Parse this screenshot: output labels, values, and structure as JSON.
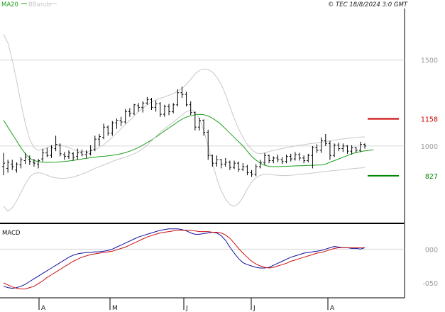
{
  "header": {
    "legend": [
      {
        "label": "MA20",
        "color": "#1aa01a"
      },
      {
        "label": "BBands",
        "color": "#c8c8c8"
      }
    ],
    "copyright": "© TEC 18/8/2024 3:0 GMT"
  },
  "chart_data": [
    {
      "type": "ohlc",
      "panel": "price",
      "title": "",
      "yticks": [
        "1500",
        "1000"
      ],
      "ylim": [
        550,
        1800
      ],
      "price_lines": [
        {
          "label": "1158",
          "value": 1158,
          "color": "#cc0000"
        },
        {
          "label": "827",
          "value": 827,
          "color": "#008800"
        }
      ],
      "series": [
        {
          "name": "MA20",
          "color": "#1aa01a",
          "values": [
            1150,
            1110,
            1070,
            1030,
            990,
            955,
            930,
            915,
            910,
            905,
            905,
            905,
            906,
            908,
            910,
            913,
            916,
            920,
            924,
            928,
            932,
            935,
            938,
            940,
            943,
            946,
            950,
            955,
            962,
            970,
            980,
            992,
            1005,
            1020,
            1035,
            1052,
            1070,
            1088,
            1105,
            1122,
            1140,
            1156,
            1168,
            1176,
            1182,
            1184,
            1182,
            1175,
            1162,
            1145,
            1125,
            1100,
            1075,
            1050,
            1025,
            1000,
            970,
            940,
            918,
            900,
            888,
            882,
            880,
            880,
            881,
            882,
            883,
            884,
            885,
            886,
            887,
            888,
            889,
            890,
            895,
            905,
            915,
            925,
            935,
            945,
            955,
            962,
            968,
            972,
            975,
            978
          ]
        },
        {
          "name": "BBands upper",
          "color": "#c8c8c8",
          "values": [
            1650,
            1600,
            1500,
            1380,
            1250,
            1130,
            1040,
            990,
            975,
            980,
            990,
            1000,
            1005,
            1005,
            1000,
            990,
            980,
            972,
            968,
            968,
            972,
            980,
            992,
            1008,
            1028,
            1050,
            1075,
            1100,
            1125,
            1150,
            1175,
            1200,
            1220,
            1240,
            1255,
            1268,
            1278,
            1286,
            1295,
            1305,
            1318,
            1335,
            1358,
            1388,
            1420,
            1440,
            1448,
            1445,
            1430,
            1400,
            1360,
            1300,
            1230,
            1160,
            1100,
            1050,
            1010,
            980,
            960,
            955,
            960,
            968,
            975,
            980,
            985,
            990,
            995,
            1000,
            1005,
            1008,
            1012,
            1015,
            1018,
            1022,
            1026,
            1030,
            1034,
            1038,
            1042,
            1045,
            1048,
            1050,
            1052,
            1053
          ]
        },
        {
          "name": "BBands lower",
          "color": "#c8c8c8",
          "values": [
            650,
            620,
            640,
            680,
            730,
            780,
            820,
            840,
            845,
            840,
            830,
            820,
            815,
            812,
            812,
            815,
            820,
            828,
            836,
            846,
            858,
            870,
            880,
            890,
            900,
            910,
            920,
            928,
            935,
            945,
            955,
            968,
            985,
            1005,
            1030,
            1055,
            1080,
            1100,
            1120,
            1140,
            1160,
            1180,
            1200,
            1210,
            1200,
            1160,
            1090,
            1000,
            900,
            810,
            740,
            690,
            660,
            650,
            665,
            700,
            750,
            790,
            815,
            830,
            835,
            835,
            832,
            830,
            828,
            828,
            830,
            832,
            835,
            838,
            840,
            843,
            846,
            849,
            852,
            855,
            858,
            860,
            862,
            865,
            868,
            870,
            872,
            874
          ]
        }
      ],
      "bars": [
        [
          880,
          960,
          830,
          900
        ],
        [
          870,
          920,
          845,
          905
        ],
        [
          895,
          920,
          860,
          880
        ],
        [
          860,
          905,
          845,
          895
        ],
        [
          890,
          935,
          870,
          920
        ],
        [
          915,
          960,
          895,
          935
        ],
        [
          920,
          945,
          890,
          910
        ],
        [
          905,
          925,
          880,
          900
        ],
        [
          895,
          925,
          870,
          915
        ],
        [
          925,
          985,
          910,
          960
        ],
        [
          960,
          990,
          935,
          945
        ],
        [
          945,
          1005,
          930,
          990
        ],
        [
          985,
          1060,
          970,
          1010
        ],
        [
          1005,
          1015,
          940,
          955
        ],
        [
          950,
          965,
          920,
          940
        ],
        [
          940,
          975,
          925,
          960
        ],
        [
          955,
          965,
          915,
          935
        ],
        [
          940,
          985,
          920,
          960
        ],
        [
          960,
          980,
          940,
          950
        ],
        [
          950,
          975,
          930,
          960
        ],
        [
          955,
          1005,
          945,
          975
        ],
        [
          980,
          1060,
          970,
          1040
        ],
        [
          1040,
          1070,
          1000,
          1055
        ],
        [
          1050,
          1130,
          1040,
          1110
        ],
        [
          1110,
          1120,
          1060,
          1075
        ],
        [
          1075,
          1145,
          1060,
          1135
        ],
        [
          1135,
          1160,
          1100,
          1150
        ],
        [
          1150,
          1170,
          1115,
          1140
        ],
        [
          1140,
          1215,
          1130,
          1200
        ],
        [
          1200,
          1220,
          1170,
          1190
        ],
        [
          1190,
          1245,
          1180,
          1240
        ],
        [
          1235,
          1250,
          1200,
          1225
        ],
        [
          1225,
          1260,
          1195,
          1250
        ],
        [
          1250,
          1285,
          1240,
          1270
        ],
        [
          1270,
          1280,
          1210,
          1225
        ],
        [
          1225,
          1265,
          1200,
          1245
        ],
        [
          1245,
          1255,
          1170,
          1185
        ],
        [
          1185,
          1240,
          1170,
          1230
        ],
        [
          1230,
          1245,
          1180,
          1200
        ],
        [
          1200,
          1250,
          1190,
          1240
        ],
        [
          1240,
          1330,
          1230,
          1310
        ],
        [
          1310,
          1345,
          1280,
          1300
        ],
        [
          1300,
          1315,
          1230,
          1240
        ],
        [
          1240,
          1260,
          1180,
          1195
        ],
        [
          1195,
          1200,
          1090,
          1110
        ],
        [
          1110,
          1165,
          1090,
          1150
        ],
        [
          1150,
          1155,
          1060,
          1080
        ],
        [
          1080,
          1095,
          920,
          945
        ],
        [
          945,
          950,
          880,
          900
        ],
        [
          900,
          945,
          880,
          920
        ],
        [
          920,
          925,
          870,
          895
        ],
        [
          895,
          930,
          880,
          905
        ],
        [
          905,
          915,
          860,
          875
        ],
        [
          875,
          915,
          865,
          900
        ],
        [
          900,
          910,
          850,
          865
        ],
        [
          865,
          900,
          855,
          880
        ],
        [
          880,
          890,
          830,
          845
        ],
        [
          845,
          860,
          820,
          835
        ],
        [
          835,
          895,
          825,
          880
        ],
        [
          880,
          920,
          870,
          905
        ],
        [
          905,
          960,
          890,
          945
        ],
        [
          945,
          950,
          900,
          915
        ],
        [
          915,
          940,
          900,
          930
        ],
        [
          930,
          950,
          905,
          920
        ],
        [
          920,
          935,
          895,
          910
        ],
        [
          910,
          950,
          900,
          940
        ],
        [
          940,
          955,
          910,
          925
        ],
        [
          925,
          965,
          915,
          950
        ],
        [
          950,
          960,
          915,
          930
        ],
        [
          930,
          945,
          900,
          915
        ],
        [
          915,
          955,
          905,
          945
        ],
        [
          945,
          1000,
          870,
          990
        ],
        [
          990,
          1010,
          960,
          975
        ],
        [
          975,
          1050,
          960,
          1030
        ],
        [
          1030,
          1070,
          1000,
          1015
        ],
        [
          1015,
          1030,
          920,
          945
        ],
        [
          945,
          1015,
          935,
          1005
        ],
        [
          1005,
          1020,
          970,
          985
        ],
        [
          985,
          1015,
          965,
          1000
        ],
        [
          1000,
          1005,
          955,
          970
        ],
        [
          970,
          1005,
          950,
          990
        ],
        [
          990,
          995,
          960,
          975
        ],
        [
          975,
          1025,
          965,
          1010
        ],
        [
          1010,
          1015,
          985,
          1000
        ]
      ]
    },
    {
      "type": "line",
      "panel": "macd",
      "title": "MACD",
      "yticks": [
        "000",
        "-050"
      ],
      "ylim": [
        -70,
        35
      ],
      "series": [
        {
          "name": "MACD",
          "color": "#1010a0",
          "values": [
            -55,
            -57,
            -58,
            -57,
            -55,
            -52,
            -48,
            -44,
            -40,
            -36,
            -32,
            -28,
            -24,
            -20,
            -16,
            -12,
            -9,
            -7,
            -6,
            -5,
            -5,
            -4,
            -4,
            -3,
            -2,
            0,
            3,
            6,
            9,
            12,
            15,
            18,
            20,
            22,
            24,
            26,
            28,
            29,
            30,
            30,
            30,
            29,
            27,
            24,
            22,
            22,
            23,
            24,
            25,
            24,
            20,
            13,
            3,
            -6,
            -14,
            -20,
            -23,
            -25,
            -27,
            -28,
            -28,
            -27,
            -24,
            -21,
            -18,
            -15,
            -12,
            -10,
            -8,
            -6,
            -5,
            -4,
            -3,
            -2,
            0,
            2,
            4,
            3,
            2,
            2,
            1,
            1,
            0,
            2
          ]
        },
        {
          "name": "Signal",
          "color": "#cc1010",
          "values": [
            -50,
            -53,
            -56,
            -58,
            -59,
            -59,
            -57,
            -55,
            -51,
            -47,
            -42,
            -38,
            -34,
            -30,
            -26,
            -22,
            -18,
            -15,
            -12,
            -10,
            -8,
            -7,
            -6,
            -5,
            -4,
            -3,
            -1,
            1,
            3,
            6,
            9,
            12,
            15,
            18,
            20,
            22,
            24,
            25,
            26,
            27,
            28,
            28,
            28,
            28,
            27,
            26,
            26,
            26,
            25,
            25,
            24,
            21,
            16,
            9,
            1,
            -6,
            -12,
            -18,
            -22,
            -25,
            -27,
            -28,
            -27,
            -25,
            -23,
            -21,
            -18,
            -16,
            -14,
            -12,
            -10,
            -8,
            -6,
            -5,
            -3,
            -1,
            1,
            2,
            2,
            2,
            2,
            2,
            2,
            2
          ]
        }
      ]
    }
  ],
  "x_axis": {
    "ticks": [
      "A",
      "M",
      "J",
      "J",
      "A"
    ]
  }
}
